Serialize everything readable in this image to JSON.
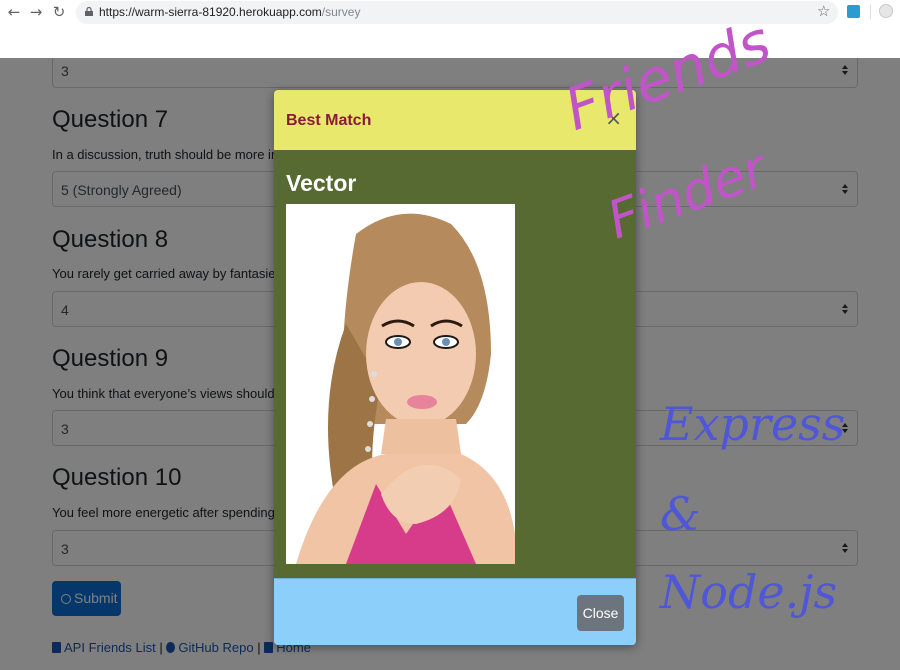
{
  "browser": {
    "url_host": "https://warm-sierra-81920.herokuapp.com",
    "url_path": "/survey",
    "back_icon": "back-arrow-icon",
    "forward_icon": "forward-arrow-icon",
    "reload_icon": "reload-icon",
    "bookmark_icon": "star-icon"
  },
  "survey": {
    "top_select_value": "3",
    "questions": [
      {
        "title": "Question 7",
        "text": "In a discussion, truth should be more impor",
        "value": "5 (Strongly Agreed)"
      },
      {
        "title": "Question 8",
        "text": "You rarely get carried away by fantasies and",
        "value": "4"
      },
      {
        "title": "Question 9",
        "text": "You think that everyone’s views should be re",
        "value": "3"
      },
      {
        "title": "Question 10",
        "text": "You feel more energetic after spending time",
        "value": "3"
      }
    ],
    "submit_label": "Submit"
  },
  "footer": {
    "api_label": "API Friends List",
    "separator": "|",
    "github_label": "GitHub Repo",
    "home_label": "Home"
  },
  "modal": {
    "title": "Best Match",
    "name": "Vector",
    "close_label": "Close",
    "close_x": "×"
  },
  "watermark": {
    "friends": "Friends",
    "finder": "Finder",
    "express": "Express",
    "ampersand": "&",
    "node": "Node.js"
  },
  "colors": {
    "modal_header": "#e8e96c",
    "modal_body": "#566a32",
    "modal_footer": "#8dcffb",
    "primary": "#0d6fd6",
    "watermark_pink": "#c254c9",
    "watermark_blue": "#4f57d6"
  }
}
